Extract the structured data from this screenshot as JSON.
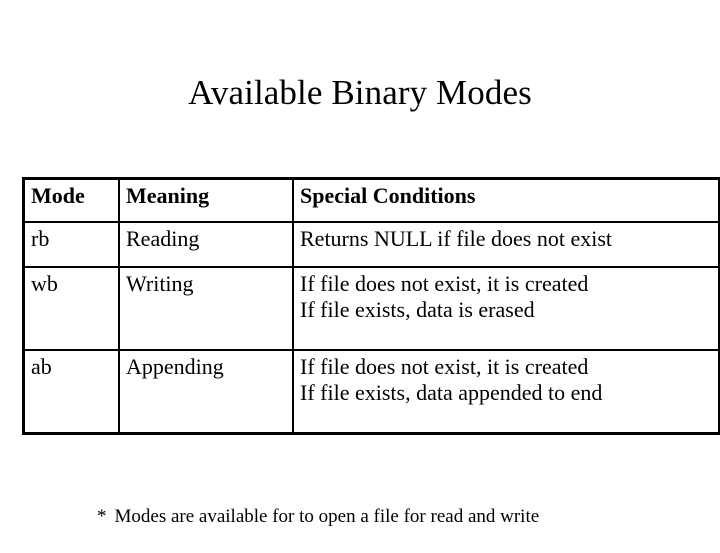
{
  "slide": {
    "title": "Available Binary Modes",
    "background_color": "#ffffff",
    "text_color": "#000000"
  },
  "table": {
    "headers": {
      "mode": "Mode",
      "meaning": "Meaning",
      "conditions": "Special Conditions"
    },
    "rows": [
      {
        "mode": "rb",
        "meaning": "Reading",
        "conditions": [
          "Returns NULL if file does not exist"
        ]
      },
      {
        "mode": "wb",
        "meaning": "Writing",
        "conditions": [
          "If file does not exist, it is created",
          "If file exists, data is erased"
        ]
      },
      {
        "mode": "ab",
        "meaning": "Appending",
        "conditions": [
          "If file does not exist, it is created",
          "If file exists, data appended to end"
        ]
      }
    ]
  },
  "footnote": {
    "marker": "*",
    "text": "Modes are available for to open a file for read and write"
  }
}
